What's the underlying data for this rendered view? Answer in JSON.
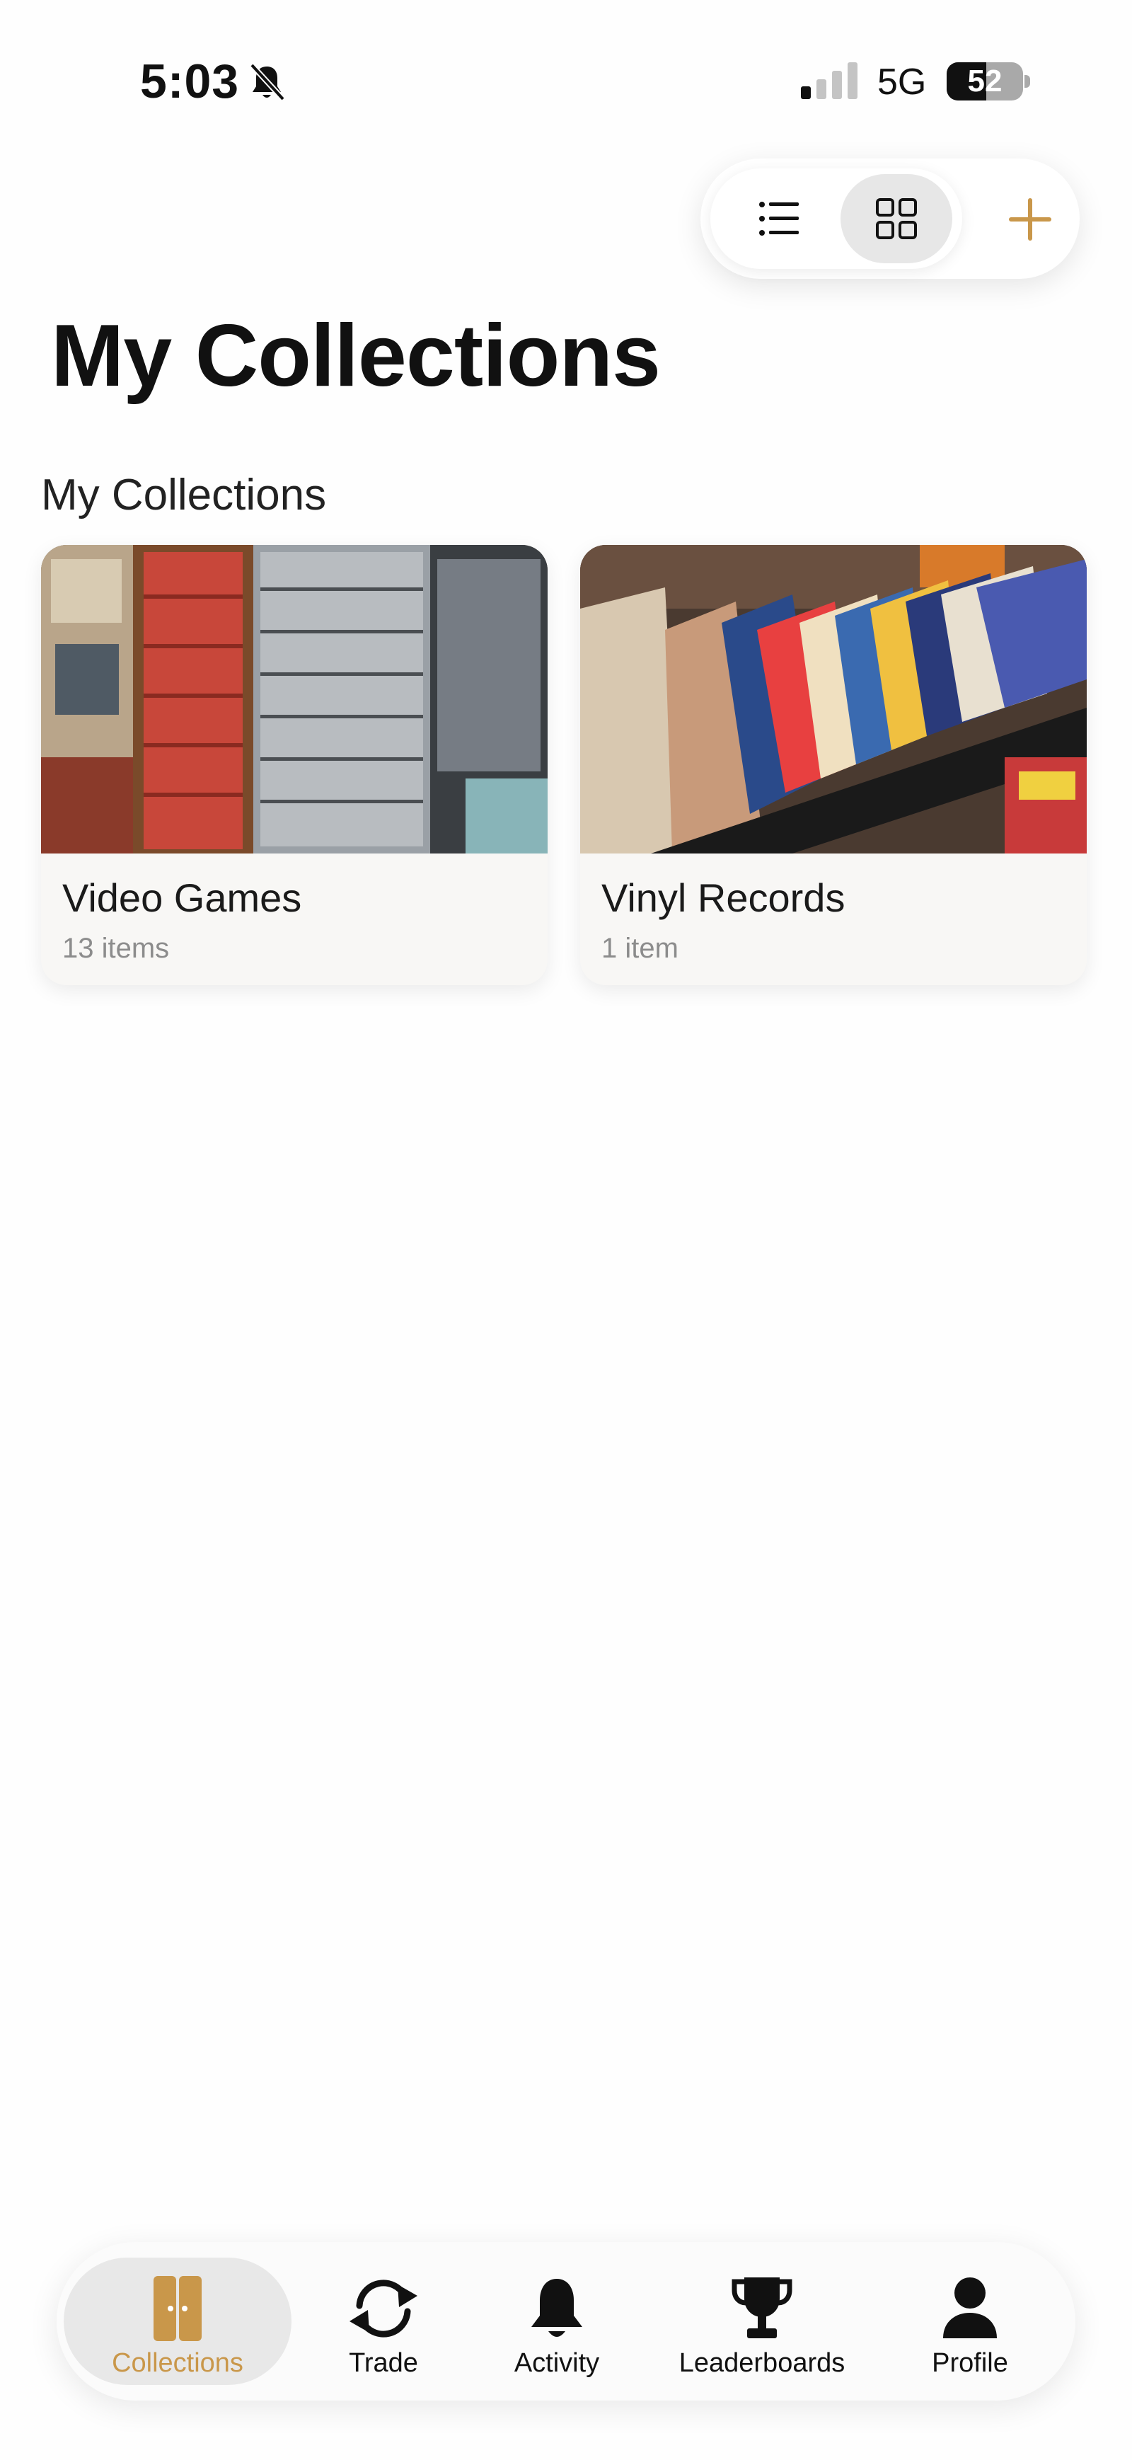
{
  "status_bar": {
    "time": "5:03",
    "network": "5G",
    "battery": "52"
  },
  "toolbar": {
    "list_icon": "list-icon",
    "grid_icon": "grid-icon",
    "add_icon": "plus-icon",
    "accent": "#c9974a"
  },
  "page": {
    "title": "My Collections",
    "section_title": "My Collections"
  },
  "collections": [
    {
      "name": "Video Games",
      "count": "13 items"
    },
    {
      "name": "Vinyl Records",
      "count": "1 item"
    }
  ],
  "nav": {
    "items": [
      {
        "label": "Collections",
        "icon": "cabinet-icon",
        "active": true
      },
      {
        "label": "Trade",
        "icon": "trade-arrows-icon",
        "active": false
      },
      {
        "label": "Activity",
        "icon": "bell-icon",
        "active": false
      },
      {
        "label": "Leaderboards",
        "icon": "trophy-icon",
        "active": false
      },
      {
        "label": "Profile",
        "icon": "person-icon",
        "active": false
      }
    ]
  }
}
